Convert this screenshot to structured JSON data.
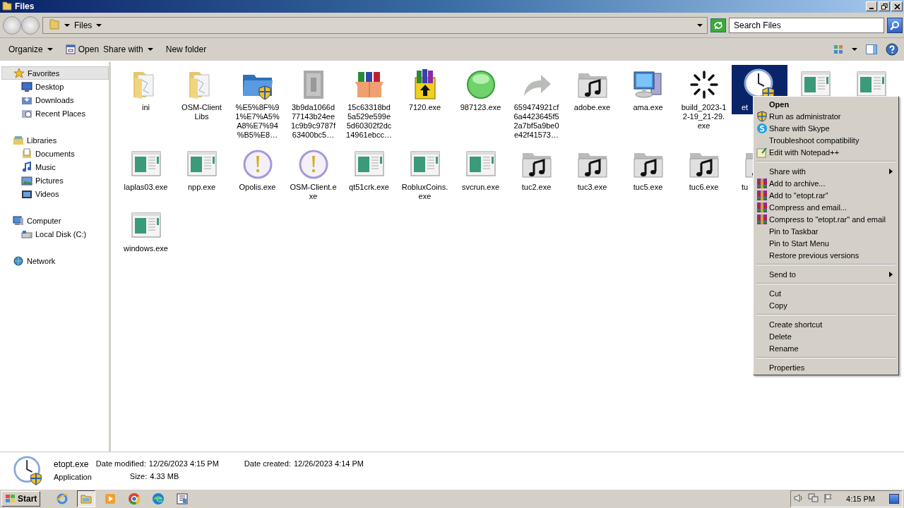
{
  "window": {
    "title": "Files"
  },
  "address_bar": {
    "path": "Files",
    "search": {
      "placeholder": "Search Files"
    }
  },
  "toolbar": {
    "buttons": [
      {
        "label": "Organize",
        "kind": "dropdown"
      },
      {
        "label": "Open",
        "kind": "open"
      },
      {
        "label": "Share with",
        "kind": "dropdown"
      },
      {
        "label": "New folder",
        "kind": "plain"
      }
    ]
  },
  "sidebar": {
    "groups": [
      {
        "label": "Favorites",
        "selected": true,
        "children": [
          {
            "label": "Desktop",
            "selected": false
          },
          {
            "label": "Downloads",
            "selected": false
          },
          {
            "label": "Recent Places",
            "selected": false
          }
        ]
      },
      {
        "label": "Libraries",
        "selected": false,
        "children": [
          {
            "label": "Documents",
            "selected": false
          },
          {
            "label": "Music",
            "selected": false
          },
          {
            "label": "Pictures",
            "selected": false
          },
          {
            "label": "Videos",
            "selected": false
          }
        ]
      },
      {
        "label": "Computer",
        "selected": false,
        "children": [
          {
            "label": "Local Disk (C:)",
            "selected": false
          }
        ]
      },
      {
        "label": "Network",
        "selected": false
      }
    ]
  },
  "files": {
    "rows": [
      [
        {
          "label_lines": [
            "ini"
          ],
          "kind": "folder",
          "selected": false
        },
        {
          "label_lines": [
            "OSM-Client",
            "Libs"
          ],
          "kind": "folder",
          "selected": false
        },
        {
          "label_lines": [
            "%E5%8F%9",
            "1%E7%A5%",
            "A8%E7%94",
            "%B5%E8…"
          ],
          "kind": "shield-folder",
          "selected": false
        },
        {
          "label_lines": [
            "3b9da1066d",
            "77143b24ee",
            "1c9b9c9787f",
            "63400bc5…"
          ],
          "kind": "blurred",
          "selected": false
        },
        {
          "label_lines": [
            "15c63318bd",
            "5a529e599e",
            "5d60302f2dc",
            "14961ebcc…"
          ],
          "kind": "archive-box",
          "selected": false
        },
        {
          "label_lines": [
            "7120.exe"
          ],
          "kind": "archive-books",
          "selected": false
        },
        {
          "label_lines": [
            "987123.exe"
          ],
          "kind": "orb",
          "selected": false
        },
        {
          "label_lines": [
            "659474921cf",
            "6a4423645f5",
            "2a7bf5a9be0",
            "e42f41573…"
          ],
          "kind": "arrow",
          "selected": false
        },
        {
          "label_lines": [
            "adobe.exe"
          ],
          "kind": "music-folder",
          "selected": false
        },
        {
          "label_lines": [
            "ama.exe"
          ],
          "kind": "computer",
          "selected": false
        },
        {
          "label_lines": [
            "build_2023-1",
            "2-19_21-29.",
            "exe"
          ],
          "kind": "spinner",
          "selected": false
        },
        {
          "label_lines": [
            "et"
          ],
          "kind": "clock",
          "selected": true
        },
        {
          "kind": "app",
          "selected": false
        },
        {
          "kind": "app",
          "selected": false
        }
      ],
      [
        {
          "label_lines": [
            "laplas03.exe"
          ],
          "kind": "app",
          "selected": false
        },
        {
          "label_lines": [
            "npp.exe"
          ],
          "kind": "app",
          "selected": false
        },
        {
          "label_lines": [
            "Opolis.exe"
          ],
          "kind": "alert-orb",
          "selected": false
        },
        {
          "label_lines": [
            "OSM-Client.e",
            "xe"
          ],
          "kind": "alert-orb",
          "selected": false
        },
        {
          "label_lines": [
            "qt51crk.exe"
          ],
          "kind": "app",
          "selected": false
        },
        {
          "label_lines": [
            "RobluxCoins.",
            "exe"
          ],
          "kind": "app",
          "selected": false
        },
        {
          "label_lines": [
            "svcrun.exe"
          ],
          "kind": "app",
          "selected": false
        },
        {
          "label_lines": [
            "tuc2.exe"
          ],
          "kind": "music-folder",
          "selected": false
        },
        {
          "label_lines": [
            "tuc3.exe"
          ],
          "kind": "music-folder",
          "selected": false
        },
        {
          "label_lines": [
            "tuc5.exe"
          ],
          "kind": "music-folder",
          "selected": false
        },
        {
          "label_lines": [
            "tuc6.exe"
          ],
          "kind": "music-folder",
          "selected": false
        },
        {
          "label_lines": [
            "tu"
          ],
          "kind": "music-folder",
          "selected": false
        }
      ],
      [
        {
          "label_lines": [
            "windows.exe"
          ],
          "kind": "app",
          "selected": false
        }
      ]
    ]
  },
  "context_menu": {
    "groups": [
      [
        {
          "label": "Open",
          "default": true,
          "submenu": false
        },
        {
          "label": "Run as administrator",
          "default": false,
          "kind": "shield",
          "submenu": false
        },
        {
          "label": "Share with Skype",
          "default": false,
          "kind": "skype",
          "submenu": false
        },
        {
          "label": "Troubleshoot compatibility",
          "default": false,
          "submenu": false
        },
        {
          "label": "Edit with Notepad++",
          "default": false,
          "kind": "notepad",
          "submenu": false
        }
      ],
      [
        {
          "label": "Share with",
          "default": false,
          "submenu": true
        },
        {
          "label": "Add to archive...",
          "default": false,
          "kind": "archive",
          "submenu": false
        },
        {
          "label": "Add to \"etopt.rar\"",
          "default": false,
          "kind": "archive",
          "submenu": false
        },
        {
          "label": "Compress and email...",
          "default": false,
          "kind": "archive",
          "submenu": false
        },
        {
          "label": "Compress to \"etopt.rar\" and email",
          "default": false,
          "kind": "archive",
          "submenu": false
        },
        {
          "label": "Pin to Taskbar",
          "default": false,
          "submenu": false
        },
        {
          "label": "Pin to Start Menu",
          "default": false,
          "submenu": false
        },
        {
          "label": "Restore previous versions",
          "default": false,
          "submenu": false
        }
      ],
      [
        {
          "label": "Send to",
          "default": false,
          "submenu": true
        }
      ],
      [
        {
          "label": "Cut",
          "default": false,
          "submenu": false
        },
        {
          "label": "Copy",
          "default": false,
          "submenu": false
        }
      ],
      [
        {
          "label": "Create shortcut",
          "default": false,
          "submenu": false
        },
        {
          "label": "Delete",
          "default": false,
          "submenu": false
        },
        {
          "label": "Rename",
          "default": false,
          "submenu": false
        }
      ],
      [
        {
          "label": "Properties",
          "default": false,
          "submenu": false
        }
      ]
    ]
  },
  "details": {
    "name": "etopt.exe",
    "type": "Application",
    "fields": [
      {
        "label": "Date modified:",
        "value": "12/26/2023 4:15 PM"
      },
      {
        "label": "Size:",
        "value": "4.33 MB"
      },
      {
        "label": "Date created:",
        "value": "12/26/2023 4:14 PM"
      }
    ]
  },
  "taskbar": {
    "start": "Start",
    "apps": [
      {
        "kind": "ie",
        "active": false
      },
      {
        "kind": "explorer",
        "active": true
      },
      {
        "kind": "media",
        "active": false
      },
      {
        "kind": "chrome",
        "active": false
      },
      {
        "kind": "edge",
        "active": false
      },
      {
        "kind": "tool",
        "active": false
      }
    ],
    "clock": "4:15 PM"
  }
}
